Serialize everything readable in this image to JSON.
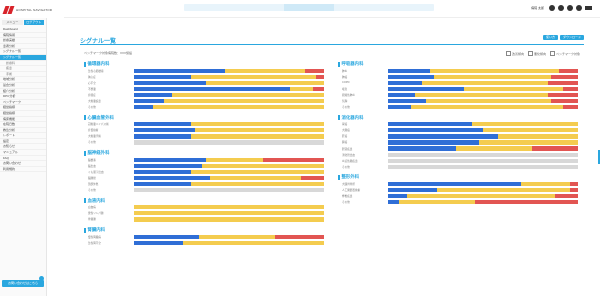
{
  "colors": {
    "accent": "#2aa7df",
    "blue": "#2f6ed6",
    "yellow": "#f4cc4f",
    "red": "#e25552",
    "gray": "#d8d8d8"
  },
  "logo": {
    "text": "HOSPITAL NAVIGATOR"
  },
  "header": {
    "user": "病院 太郎"
  },
  "sidebar": {
    "tabs": [
      "メニュー",
      "ログアウト"
    ],
    "items": [
      {
        "label": "Dashboard",
        "kind": "item"
      },
      {
        "label": "病院情報",
        "kind": "item"
      },
      {
        "label": "診療実績",
        "kind": "item"
      },
      {
        "label": "患者分析",
        "kind": "item"
      },
      {
        "label": "シグナル一覧",
        "kind": "item"
      },
      {
        "label": "シグナル一覧",
        "kind": "highlight"
      },
      {
        "label": "診療科",
        "kind": "sub"
      },
      {
        "label": "疾患",
        "kind": "sub"
      },
      {
        "label": "手術",
        "kind": "sub"
      },
      {
        "label": "地域分析",
        "kind": "item"
      },
      {
        "label": "競合分析",
        "kind": "item"
      },
      {
        "label": "紹介分析",
        "kind": "item"
      },
      {
        "label": "DPC分析",
        "kind": "item"
      },
      {
        "label": "ベンチマーク",
        "kind": "item"
      },
      {
        "label": "経営指標",
        "kind": "item"
      },
      {
        "label": "経営指標",
        "kind": "item"
      },
      {
        "label": "病床機能",
        "kind": "item"
      },
      {
        "label": "在院日数",
        "kind": "item"
      },
      {
        "label": "救急分析",
        "kind": "item"
      },
      {
        "label": "レポート",
        "kind": "item"
      },
      {
        "label": "設定",
        "kind": "item"
      },
      {
        "label": "お知らせ",
        "kind": "item"
      },
      {
        "label": "マニュアル",
        "kind": "item"
      },
      {
        "label": "FAQ",
        "kind": "item"
      },
      {
        "label": "お問い合わせ",
        "kind": "item"
      },
      {
        "label": "利用規約",
        "kind": "item"
      }
    ],
    "bottom_button": "お問い合わせはこちら"
  },
  "main": {
    "title": "シグナル一覧",
    "buttons": [
      "使い方",
      "ダウンロード"
    ],
    "sub_info": "ベンチマーク対象病院数：XXX施設",
    "legend": [
      "改善傾向",
      "悪化傾向",
      "ベンチマーク対象"
    ]
  },
  "groups_left": [
    {
      "title": "循環器内科",
      "rows": [
        {
          "label": "急性心筋梗塞",
          "segments": [
            [
              "blue",
              0.48
            ],
            [
              "yellow",
              0.42
            ],
            [
              "red",
              0.1
            ]
          ]
        },
        {
          "label": "狭心症",
          "segments": [
            [
              "blue",
              0.3
            ],
            [
              "yellow",
              0.66
            ],
            [
              "red",
              0.04
            ]
          ]
        },
        {
          "label": "心不全",
          "segments": [
            [
              "blue",
              0.38
            ],
            [
              "yellow",
              0.62
            ]
          ]
        },
        {
          "label": "不整脈",
          "segments": [
            [
              "blue",
              0.82
            ],
            [
              "yellow",
              0.12
            ],
            [
              "red",
              0.06
            ]
          ]
        },
        {
          "label": "弁膜症",
          "segments": [
            [
              "blue",
              0.2
            ],
            [
              "yellow",
              0.8
            ]
          ]
        },
        {
          "label": "大動脈疾患",
          "segments": [
            [
              "blue",
              0.16
            ],
            [
              "yellow",
              0.84
            ]
          ]
        },
        {
          "label": "その他",
          "segments": [
            [
              "blue",
              0.1
            ],
            [
              "yellow",
              0.9
            ]
          ]
        }
      ]
    },
    {
      "title": "心臓血管外科",
      "rows": [
        {
          "label": "冠動脈バイパス術",
          "segments": [
            [
              "blue",
              0.3
            ],
            [
              "yellow",
              0.7
            ]
          ]
        },
        {
          "label": "弁置換術",
          "segments": [
            [
              "blue",
              0.32
            ],
            [
              "yellow",
              0.68
            ]
          ]
        },
        {
          "label": "大動脈手術",
          "segments": [
            [
              "blue",
              0.3
            ],
            [
              "yellow",
              0.7
            ]
          ]
        },
        {
          "label": "その他",
          "segments": [
            [
              "gray",
              1.0
            ]
          ]
        }
      ]
    },
    {
      "title": "脳神経外科",
      "rows": [
        {
          "label": "脳梗塞",
          "segments": [
            [
              "blue",
              0.38
            ],
            [
              "yellow",
              0.3
            ],
            [
              "red",
              0.32
            ]
          ]
        },
        {
          "label": "脳出血",
          "segments": [
            [
              "blue",
              0.36
            ],
            [
              "yellow",
              0.64
            ]
          ]
        },
        {
          "label": "くも膜下出血",
          "segments": [
            [
              "blue",
              0.3
            ],
            [
              "yellow",
              0.7
            ]
          ]
        },
        {
          "label": "脳腫瘍",
          "segments": [
            [
              "blue",
              0.4
            ],
            [
              "yellow",
              0.48
            ],
            [
              "red",
              0.12
            ]
          ]
        },
        {
          "label": "頭部外傷",
          "segments": [
            [
              "blue",
              0.3
            ],
            [
              "yellow",
              0.7
            ]
          ]
        },
        {
          "label": "その他",
          "segments": [
            [
              "gray",
              1.0
            ]
          ]
        }
      ]
    },
    {
      "title": "血液内科",
      "rows": [
        {
          "label": "白血病",
          "segments": [
            [
              "yellow",
              1.0
            ]
          ]
        },
        {
          "label": "悪性リンパ腫",
          "segments": [
            [
              "yellow",
              1.0
            ]
          ]
        },
        {
          "label": "骨髄腫",
          "segments": [
            [
              "yellow",
              1.0
            ]
          ]
        }
      ]
    },
    {
      "title": "腎臓内科",
      "rows": [
        {
          "label": "慢性腎臓病",
          "segments": [
            [
              "blue",
              0.34
            ],
            [
              "yellow",
              0.4
            ],
            [
              "red",
              0.26
            ]
          ]
        },
        {
          "label": "急性腎不全",
          "segments": [
            [
              "blue",
              0.26
            ],
            [
              "yellow",
              0.74
            ]
          ]
        }
      ]
    }
  ],
  "groups_right": [
    {
      "title": "呼吸器内科",
      "rows": [
        {
          "label": "肺炎",
          "segments": [
            [
              "blue",
              0.22
            ],
            [
              "yellow",
              0.68
            ],
            [
              "red",
              0.1
            ]
          ]
        },
        {
          "label": "肺癌",
          "segments": [
            [
              "blue",
              0.24
            ],
            [
              "yellow",
              0.62
            ],
            [
              "red",
              0.14
            ]
          ]
        },
        {
          "label": "COPD",
          "segments": [
            [
              "blue",
              0.18
            ],
            [
              "yellow",
              0.66
            ],
            [
              "red",
              0.16
            ]
          ]
        },
        {
          "label": "喘息",
          "segments": [
            [
              "blue",
              0.4
            ],
            [
              "yellow",
              0.52
            ],
            [
              "red",
              0.08
            ]
          ]
        },
        {
          "label": "間質性肺炎",
          "segments": [
            [
              "blue",
              0.14
            ],
            [
              "yellow",
              0.7
            ],
            [
              "red",
              0.16
            ]
          ]
        },
        {
          "label": "気胸",
          "segments": [
            [
              "blue",
              0.2
            ],
            [
              "yellow",
              0.66
            ],
            [
              "red",
              0.14
            ]
          ]
        },
        {
          "label": "その他",
          "segments": [
            [
              "blue",
              0.12
            ],
            [
              "yellow",
              0.8
            ],
            [
              "red",
              0.08
            ]
          ]
        }
      ]
    },
    {
      "title": "消化器内科",
      "rows": [
        {
          "label": "胃癌",
          "segments": [
            [
              "blue",
              0.44
            ],
            [
              "yellow",
              0.56
            ]
          ]
        },
        {
          "label": "大腸癌",
          "segments": [
            [
              "blue",
              0.5
            ],
            [
              "yellow",
              0.5
            ]
          ]
        },
        {
          "label": "肝癌",
          "segments": [
            [
              "blue",
              0.58
            ],
            [
              "yellow",
              0.42
            ]
          ]
        },
        {
          "label": "膵癌",
          "segments": [
            [
              "blue",
              0.48
            ],
            [
              "yellow",
              0.52
            ]
          ]
        },
        {
          "label": "胆道疾患",
          "segments": [
            [
              "blue",
              0.36
            ],
            [
              "yellow",
              0.4
            ],
            [
              "red",
              0.24
            ]
          ]
        },
        {
          "label": "消化管出血",
          "segments": [
            [
              "gray",
              1.0
            ]
          ]
        },
        {
          "label": "炎症性腸疾患",
          "segments": [
            [
              "gray",
              1.0
            ]
          ]
        },
        {
          "label": "その他",
          "segments": [
            [
              "gray",
              1.0
            ]
          ]
        }
      ]
    },
    {
      "title": "整形外科",
      "rows": [
        {
          "label": "大腿骨骨折",
          "segments": [
            [
              "blue",
              0.7
            ],
            [
              "yellow",
              0.26
            ],
            [
              "red",
              0.04
            ]
          ]
        },
        {
          "label": "人工関節置換術",
          "segments": [
            [
              "blue",
              0.26
            ],
            [
              "yellow",
              0.7
            ],
            [
              "red",
              0.04
            ]
          ]
        },
        {
          "label": "脊椎疾患",
          "segments": [
            [
              "blue",
              0.1
            ],
            [
              "yellow",
              0.78
            ],
            [
              "red",
              0.12
            ]
          ]
        },
        {
          "label": "その他",
          "segments": [
            [
              "blue",
              0.06
            ],
            [
              "yellow",
              0.4
            ],
            [
              "red",
              0.54
            ]
          ]
        }
      ]
    }
  ]
}
